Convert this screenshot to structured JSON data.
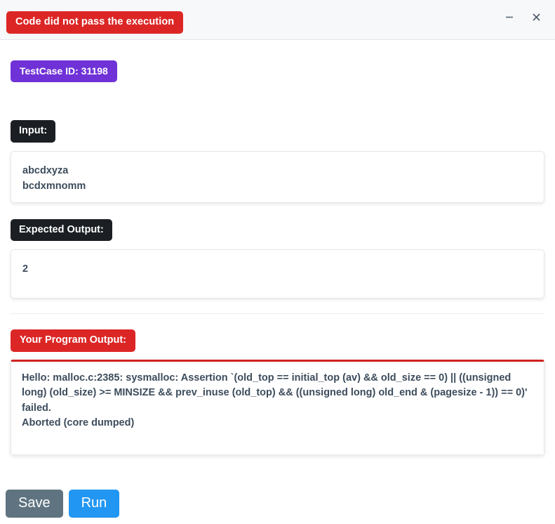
{
  "window": {
    "status_message": "Code did not pass the execution",
    "status_color": "#dc2626",
    "controls": {
      "minimize_label": "Minimize",
      "close_label": "Close"
    }
  },
  "testcase": {
    "badge_label": "TestCase ID: 31198",
    "badge_color": "#6f32d6"
  },
  "sections": {
    "input": {
      "label": "Input:",
      "value": "abcdxyza\nbcdxmnomm"
    },
    "expected_output": {
      "label": "Expected Output:",
      "value": "2"
    },
    "program_output": {
      "label": "Your Program Output:",
      "label_color": "#dc2626",
      "value": "Hello: malloc.c:2385: sysmalloc: Assertion `(old_top == initial_top (av) && old_size == 0) || ((unsigned long) (old_size) >= MINSIZE && prev_inuse (old_top) && ((unsigned long) old_end & (pagesize - 1)) == 0)' failed.\nAborted (core dumped)"
    }
  },
  "footer": {
    "save_label": "Save",
    "run_label": "Run",
    "save_color": "#5f7480",
    "run_color": "#2196f3"
  }
}
